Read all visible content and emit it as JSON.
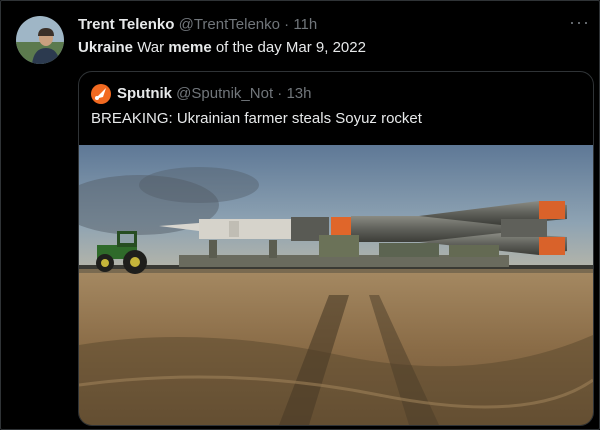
{
  "tweet": {
    "display_name": "Trent Telenko",
    "handle": "@TrentTelenko",
    "separator": "·",
    "time": "11h",
    "text_bold_1": "Ukraine",
    "text_plain_1": " War ",
    "text_bold_2": "meme",
    "text_plain_2": " of the day Mar 9, 2022",
    "more_label": "···"
  },
  "quote": {
    "display_name": "Sputnik",
    "handle": "@Sputnik_Not",
    "separator": "·",
    "time": "13h",
    "text": "BREAKING: Ukrainian farmer steals Soyuz rocket"
  },
  "colors": {
    "background": "#000000",
    "text_primary": "#e7e9ea",
    "text_secondary": "#71767b",
    "border": "#2f3336",
    "sputnik_brand": "#f26a21"
  }
}
